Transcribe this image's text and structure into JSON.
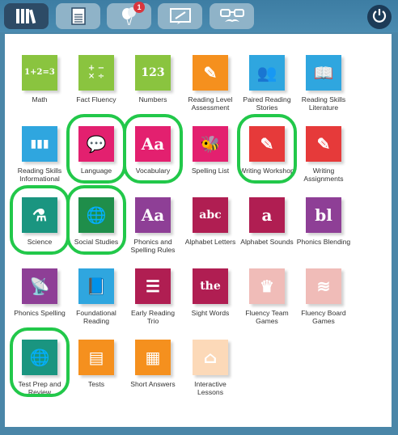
{
  "topbar": {
    "tabs": [
      {
        "name": "library-tab",
        "icon": "books-icon",
        "active": true
      },
      {
        "name": "assignments-tab",
        "icon": "graded-paper-icon",
        "active": false
      },
      {
        "name": "rewards-tab",
        "icon": "balloons-icon",
        "active": false,
        "badge": "1"
      },
      {
        "name": "messages-tab",
        "icon": "chat-screen-icon",
        "active": false
      },
      {
        "name": "avatar-tab",
        "icon": "glasses-mustache-icon",
        "active": false
      }
    ],
    "power_icon": "power-icon"
  },
  "tiles": [
    {
      "name": "math",
      "label": "Math",
      "color": "#8ac43f",
      "glyph": "1+2=3"
    },
    {
      "name": "fact-fluency",
      "label": "Fact Fluency",
      "color": "#8ac43f",
      "glyph": "+ −\n× ÷"
    },
    {
      "name": "numbers",
      "label": "Numbers",
      "color": "#8ac43f",
      "glyph": "123"
    },
    {
      "name": "reading-level-assessment",
      "label": "Reading Level Assessment",
      "color": "#f5901e",
      "glyph": "✎"
    },
    {
      "name": "paired-reading-stories",
      "label": "Paired Reading Stories",
      "color": "#2fa6df",
      "glyph": "👥"
    },
    {
      "name": "reading-skills-literature",
      "label": "Reading Skills Literature",
      "color": "#2fa6df",
      "glyph": "📖"
    },
    {
      "name": "reading-skills-informational",
      "label": "Reading Skills Informational",
      "color": "#2fa6df",
      "glyph": "▮▮▮"
    },
    {
      "name": "language",
      "label": "Language",
      "color": "#e3206f",
      "glyph": "💬"
    },
    {
      "name": "vocabulary",
      "label": "Vocabulary",
      "color": "#e3206f",
      "glyph": "Aa"
    },
    {
      "name": "spelling-list",
      "label": "Spelling List",
      "color": "#e3206f",
      "glyph": "🐝"
    },
    {
      "name": "writing-workshop",
      "label": "Writing Workshop",
      "color": "#e63a3a",
      "glyph": "✎"
    },
    {
      "name": "writing-assignments",
      "label": "Writing Assignments",
      "color": "#e63a3a",
      "glyph": "✎"
    },
    {
      "name": "science",
      "label": "Science",
      "color": "#1a9580",
      "glyph": "⚗"
    },
    {
      "name": "social-studies",
      "label": "Social Studies",
      "color": "#1f8e4a",
      "glyph": "🌐"
    },
    {
      "name": "phonics-and-spelling-rules",
      "label": "Phonics and Spelling Rules",
      "color": "#8e3f96",
      "glyph": "Aa"
    },
    {
      "name": "alphabet-letters",
      "label": "Alphabet Letters",
      "color": "#b01e52",
      "glyph": "abc"
    },
    {
      "name": "alphabet-sounds",
      "label": "Alphabet Sounds",
      "color": "#b01e52",
      "glyph": "a"
    },
    {
      "name": "phonics-blending",
      "label": "Phonics Blending",
      "color": "#8e3f96",
      "glyph": "bl"
    },
    {
      "name": "phonics-spelling",
      "label": "Phonics Spelling",
      "color": "#8e3f96",
      "glyph": "📡"
    },
    {
      "name": "foundational-reading",
      "label": "Foundational Reading",
      "color": "#2fa6df",
      "glyph": "📘"
    },
    {
      "name": "early-reading-trio",
      "label": "Early Reading Trio",
      "color": "#b01e52",
      "glyph": "☰"
    },
    {
      "name": "sight-words",
      "label": "Sight Words",
      "color": "#b01e52",
      "glyph": "the"
    },
    {
      "name": "fluency-team-games",
      "label": "Fluency Team Games",
      "color": "#f0bcb8",
      "glyph": "♛"
    },
    {
      "name": "fluency-board-games",
      "label": "Fluency Board Games",
      "color": "#f0bcb8",
      "glyph": "≋"
    },
    {
      "name": "test-prep-and-review",
      "label": "Test Prep and Review",
      "color": "#1a9580",
      "glyph": "🌐"
    },
    {
      "name": "tests",
      "label": "Tests",
      "color": "#f5901e",
      "glyph": "▤"
    },
    {
      "name": "short-answers",
      "label": "Short Answers",
      "color": "#f5901e",
      "glyph": "▦"
    },
    {
      "name": "interactive-lessons",
      "label": "Interactive Lessons",
      "color": "#fcd9b8",
      "glyph": "⌂"
    }
  ],
  "highlighted": [
    "language",
    "vocabulary",
    "writing-workshop",
    "science",
    "social-studies",
    "test-prep-and-review"
  ]
}
